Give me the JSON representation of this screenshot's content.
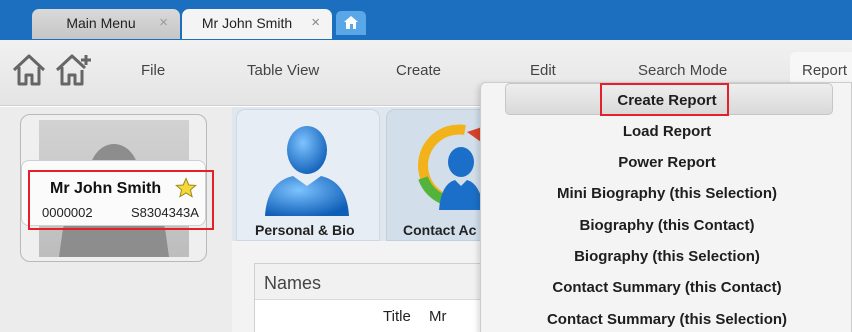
{
  "tabs": [
    {
      "label": "Main Menu",
      "close": "×"
    },
    {
      "label": "Mr John Smith",
      "close": "×"
    }
  ],
  "toolbar": {
    "icons": [
      "home-icon",
      "home-add-icon"
    ],
    "menu": {
      "file": "File",
      "table_view": "Table View",
      "create": "Create",
      "edit": "Edit",
      "search_mode": "Search Mode",
      "report": "Report"
    }
  },
  "person": {
    "name": "Mr John Smith",
    "id": "0000002",
    "code": "S8304343A"
  },
  "cards": {
    "personal": "Personal & Bio",
    "contact": "Contact Ac"
  },
  "names_panel": {
    "header": "Names",
    "title_label": "Title",
    "title_value": "Mr"
  },
  "report_menu": {
    "items": [
      "Create Report",
      "Load Report",
      "Power Report",
      "Mini Biography (this Selection)",
      "Biography (this Contact)",
      "Biography (this Selection)",
      "Contact Summary (this Contact)",
      "Contact Summary (this Selection)"
    ]
  },
  "colors": {
    "tabbar": "#1c6fbf",
    "highlight": "#e3202b",
    "accent_blue": "#1d7fd1"
  }
}
